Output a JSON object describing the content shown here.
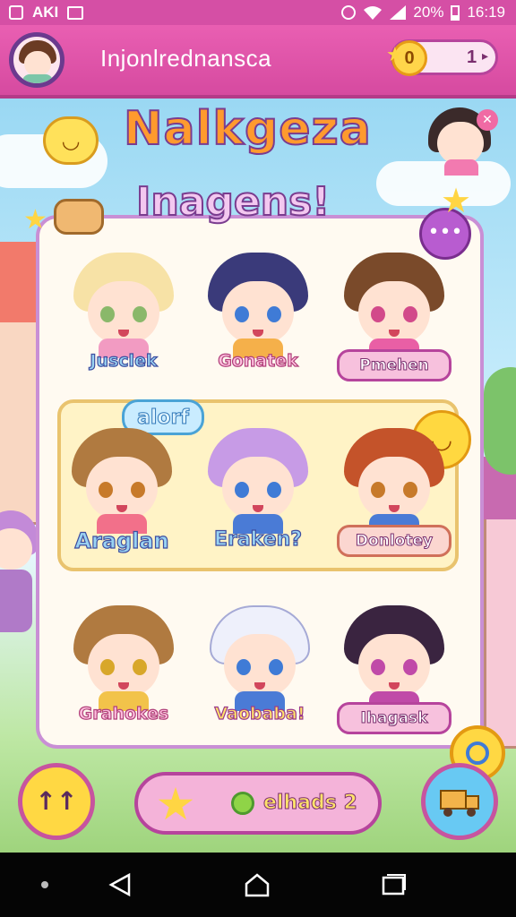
{
  "status_bar": {
    "left_text": "AKI",
    "battery_percent": "20%",
    "time": "16:19"
  },
  "header": {
    "username": "Injonlrednansca",
    "coin_symbol": "0",
    "coin_count": "1"
  },
  "title": {
    "line1": "Nalkgeza",
    "line2": "Inagens!"
  },
  "highlight_bubble": "alorf",
  "characters": [
    {
      "name": "Jusclek"
    },
    {
      "name": "Gonatek"
    },
    {
      "name": "Pmehen"
    },
    {
      "name": "Araglan"
    },
    {
      "name": "Eraken?"
    },
    {
      "name": "Donlotey"
    },
    {
      "name": "Grahokes"
    },
    {
      "name": "Vaobaba!"
    },
    {
      "name": "Ihagask"
    }
  ],
  "bottom": {
    "left_button_label": "↑↑",
    "friends_label": "elhads 2"
  },
  "icons": [
    "wifi-icon",
    "signal-icon",
    "battery-icon",
    "coin-icon",
    "star-icon",
    "chat-icon",
    "sun-icon",
    "truck-icon",
    "back-icon",
    "home-icon",
    "recent-apps-icon"
  ],
  "colors": {
    "status_bar": "#d54fa5",
    "header": "#e95fb2",
    "panel_border": "#c98fd5",
    "highlight_row": "#fff3c6"
  }
}
